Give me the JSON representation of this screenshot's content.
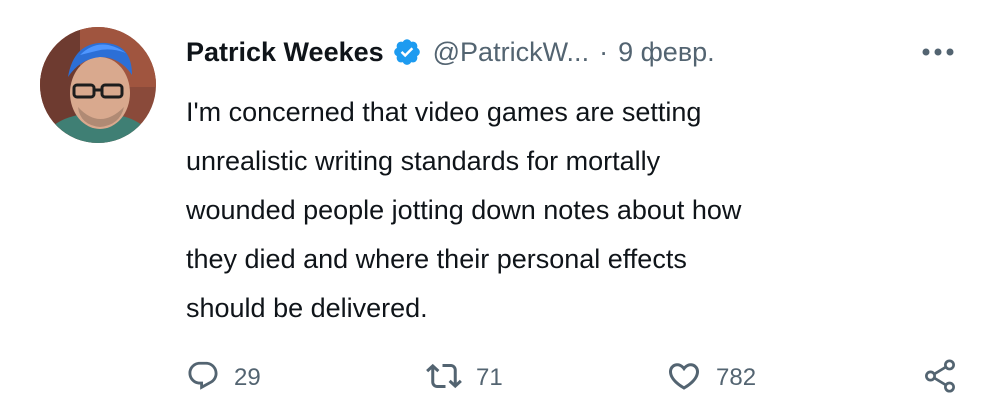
{
  "tweet": {
    "author": {
      "name": "Patrick Weekes",
      "handle": "@PatrickW...",
      "avatar_icon": "profile-photo",
      "verified_icon": "verified-badge-icon",
      "verified_color": "#1d9bf0"
    },
    "separator": "·",
    "date": "9 февр.",
    "more_icon": "more-options-icon",
    "text": "I'm concerned that video games are setting\nunrealistic writing standards for mortally\nwounded people jotting down notes about how\nthey died and where their personal effects\nshould be delivered.",
    "actions": {
      "reply": {
        "icon": "reply-icon",
        "count": "29"
      },
      "retweet": {
        "icon": "retweet-icon",
        "count": "71"
      },
      "like": {
        "icon": "heart-icon",
        "count": "782"
      },
      "share": {
        "icon": "share-icon"
      }
    },
    "colors": {
      "text": "#0f1419",
      "secondary": "#536471",
      "accent": "#1d9bf0"
    }
  }
}
